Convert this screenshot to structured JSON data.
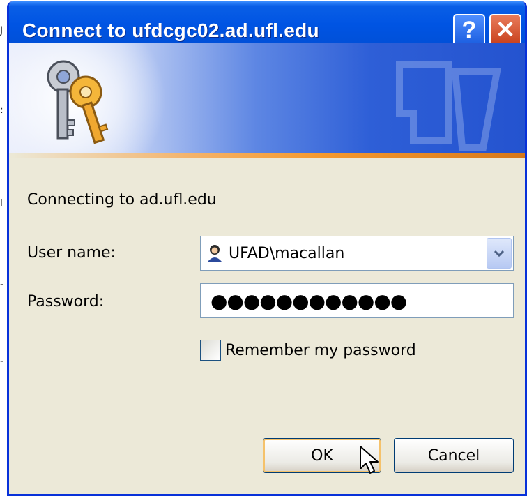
{
  "window": {
    "title": "Connect to ufdcgc02.ad.ufl.edu",
    "help_glyph": "?",
    "close_glyph": "✕"
  },
  "banner": {
    "icon": "keys-icon",
    "watermark": "keys-watermark-icon"
  },
  "form": {
    "connecting_text": "Connecting to ad.ufl.edu",
    "user_label": "User name:",
    "user_value": "UFAD\\macallan",
    "password_label": "Password:",
    "password_value": "●●●●●●●●●●●●",
    "remember_label": "Remember my password",
    "remember_checked": false
  },
  "buttons": {
    "ok": "OK",
    "cancel": "Cancel"
  },
  "colors": {
    "title_bar": "#0054e3",
    "dialog_bg": "#ece9d8",
    "accent_stripe": "#f59a2f"
  }
}
